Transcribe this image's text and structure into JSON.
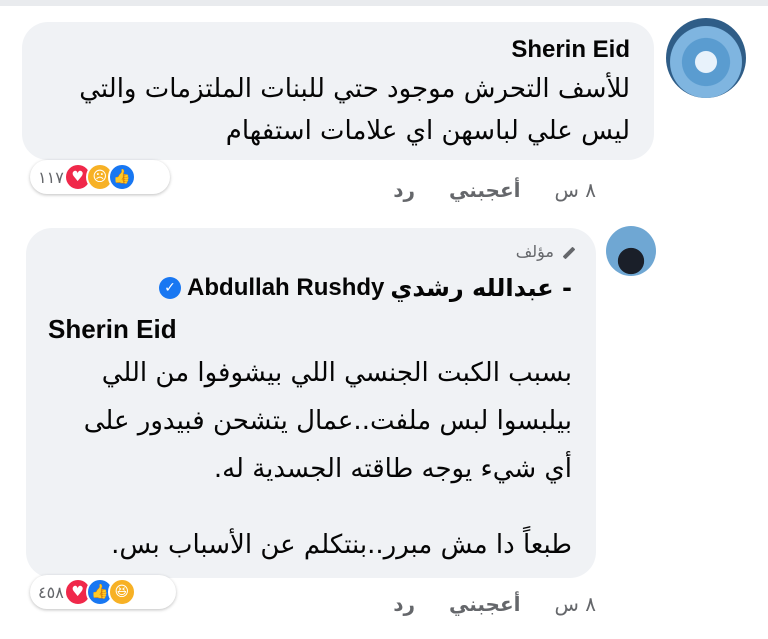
{
  "comments": [
    {
      "author": "Sherin Eid",
      "lines": [
        "للأسف التحرش موجود حتي للبنات الملتزمات والتي",
        "ليس علي لباسهن اي علامات استفهام"
      ],
      "reactions_count": "١١٧",
      "actions": {
        "time": "٨ س",
        "like": "أعجبني",
        "reply": "رد"
      }
    },
    {
      "author_badge": "مؤلف",
      "author_ar": "عبدالله رشدي -",
      "author_en": "Abdullah Rushdy",
      "mention": "Sherin Eid",
      "lines": [
        "بسبب الكبت الجنسي اللي بيشوفوا من اللي",
        "بيلبسوا لبس ملفت..عمال يتشحن فبيدور على",
        "أي شيء يوجه طاقته الجسدية له.",
        "طبعاً دا مش مبرر..بنتكلم عن الأسباب بس."
      ],
      "reactions_count": "٤٥٨",
      "actions": {
        "time": "٨ س",
        "like": "أعجبني",
        "reply": "رد"
      }
    }
  ],
  "icons": {
    "verified": "verified-badge-icon",
    "pen": "pen-icon",
    "reactions_1": [
      "like-icon",
      "sad-icon",
      "love-icon"
    ],
    "reactions_2": [
      "haha-icon",
      "like-icon",
      "love-icon"
    ]
  },
  "colors": {
    "bubble": "#f0f2f5",
    "verified": "#1877f2",
    "meta": "#65676b"
  }
}
